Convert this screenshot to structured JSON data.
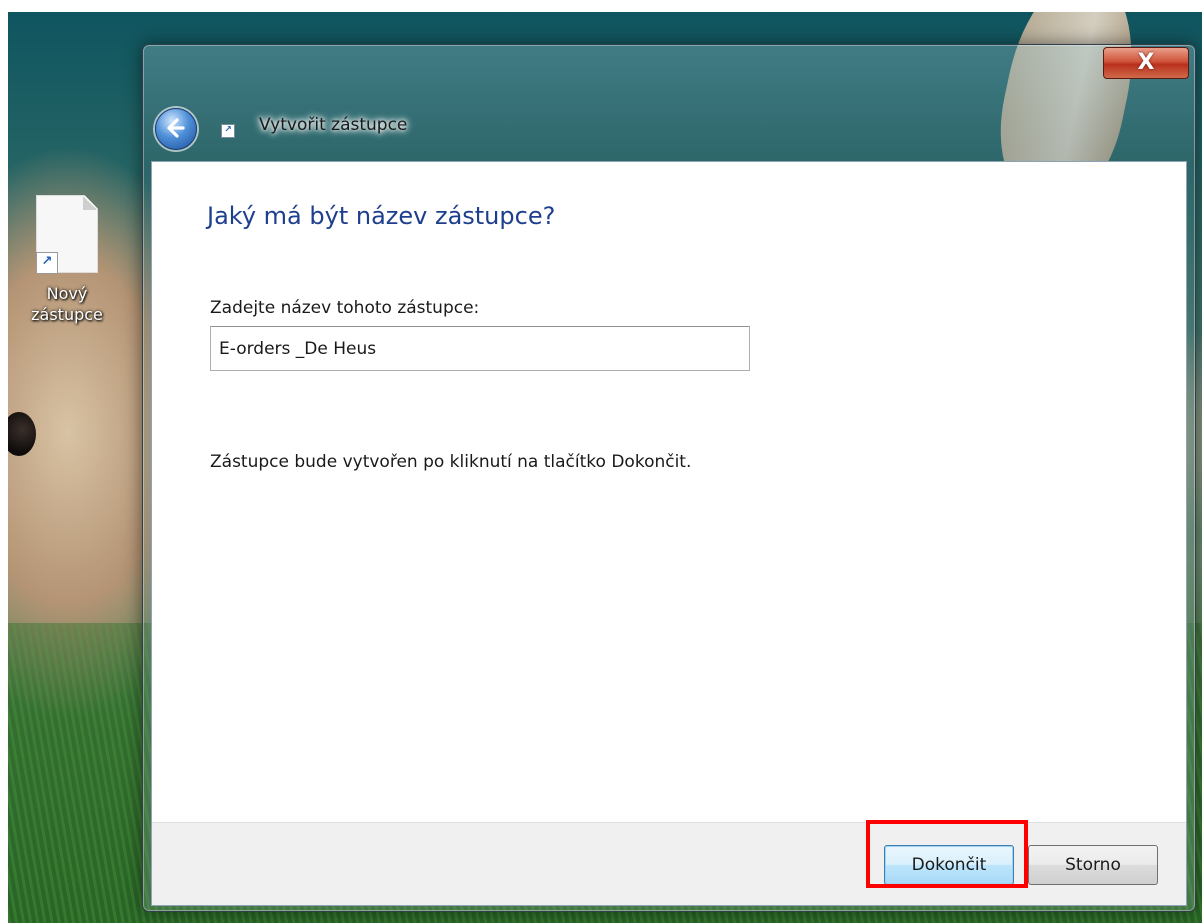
{
  "desktop": {
    "shortcut_label": "Nový zástupce",
    "icon_name": "file-shortcut-icon"
  },
  "window": {
    "title": "Vytvořit zástupce",
    "close_symbol": "X",
    "back_icon": "back-arrow-icon",
    "title_icon": "shortcut-icon"
  },
  "content": {
    "heading": "Jaký má být název zástupce?",
    "field_label": "Zadejte název tohoto zástupce:",
    "name_value": "E-orders _De Heus",
    "info": "Zástupce bude vytvořen po kliknutí na tlačítko Dokončit."
  },
  "footer": {
    "finish_label": "Dokončit",
    "cancel_label": "Storno"
  },
  "colors": {
    "heading": "#1e3f8e",
    "highlight": "#ff0000",
    "close_button": "#c7412a"
  }
}
